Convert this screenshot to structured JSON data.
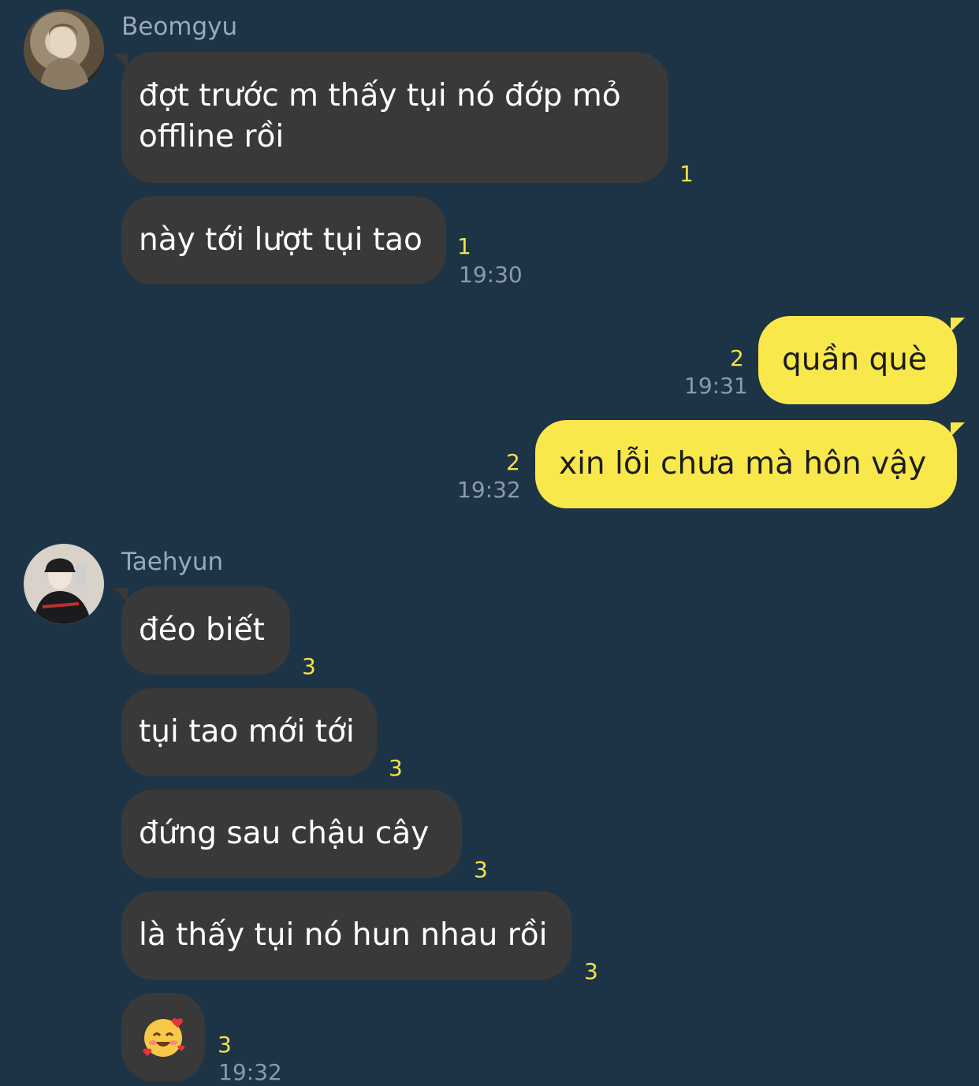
{
  "conversation": {
    "senders": {
      "first": "Beomgyu",
      "second": "Taehyun"
    },
    "messages": [
      {
        "text": "đợt trước m thấy tụi nó đớp mỏ offline rồi",
        "unread": "1"
      },
      {
        "text": "này tới lượt tụi tao",
        "unread": "1",
        "time": "19:30"
      },
      {
        "text": "quần què",
        "unread": "2",
        "time": "19:31"
      },
      {
        "text": "xin lỗi chưa mà hôn vậy",
        "unread": "2",
        "time": "19:32"
      },
      {
        "text": "đéo biết",
        "unread": "3"
      },
      {
        "text": "tụi tao mới tới",
        "unread": "3"
      },
      {
        "text": "đứng sau chậu cây",
        "unread": "3"
      },
      {
        "text": "là thấy tụi nó hun nhau rồi",
        "unread": "3"
      },
      {
        "emoji": "smiling-face-with-hearts",
        "unread": "3",
        "time": "19:32"
      }
    ]
  },
  "colors": {
    "background": "#1d3447",
    "incoming_bubble": "#393939",
    "outgoing_bubble": "#f9e84b",
    "unread_count": "#f2e24a",
    "timestamp": "#8e9aa5"
  }
}
